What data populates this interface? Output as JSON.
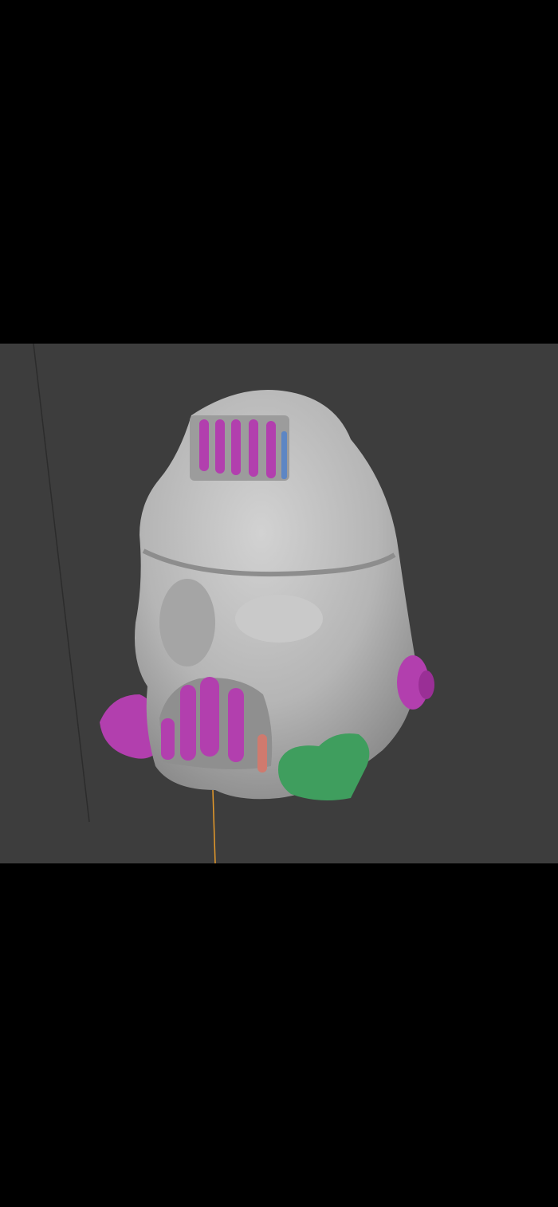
{
  "colors": {
    "viewport_background": "#3d3d3d",
    "helmet": "#b9b9b9",
    "accent_magenta": "#b23fae",
    "accent_green": "#3f9e5e",
    "accent_lime": "#9cc04a",
    "accent_blue": "#5d86c4",
    "accent_salmon": "#d07a6e",
    "origin_line": "#e69a2a"
  }
}
